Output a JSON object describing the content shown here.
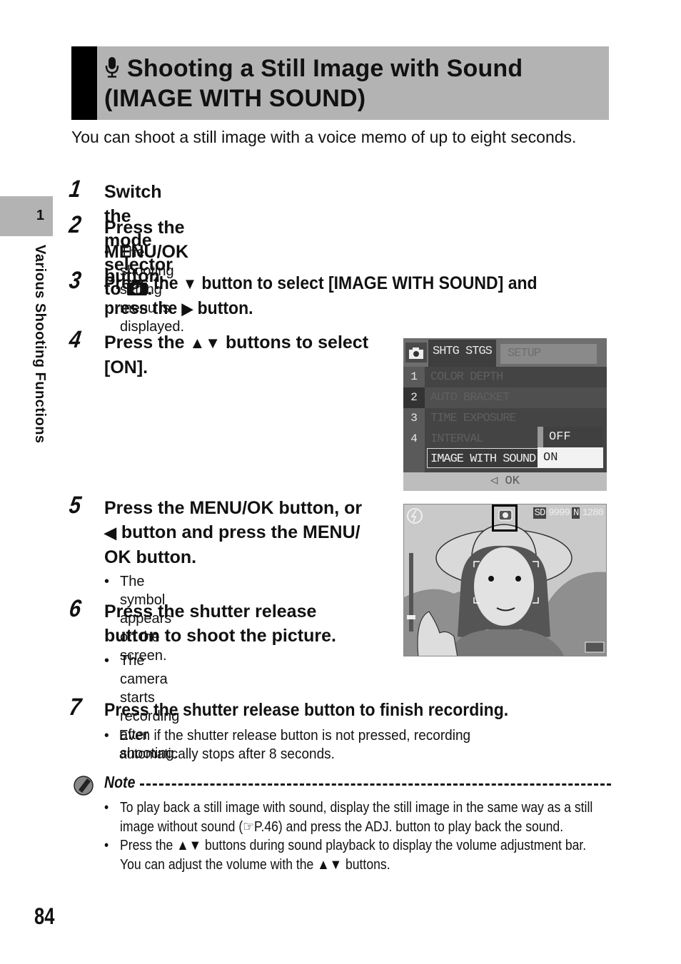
{
  "header": {
    "title_line1": "Shooting a Still Image with Sound",
    "title_line2": "(IMAGE WITH SOUND)",
    "title_icon": "microphone-icon"
  },
  "intro": "You can shoot a still image with a voice memo of up to eight seconds.",
  "sidebar": {
    "chapter_number": "1",
    "chapter_title": "Various Shooting Functions"
  },
  "steps": [
    {
      "number": "1",
      "text_before": "Switch the mode selector to ",
      "icon": "camera-icon",
      "text_after": "."
    },
    {
      "number": "2",
      "text": "Press the MENU/OK button.",
      "bullets": [
        "The shooting setting menu is displayed."
      ]
    },
    {
      "number": "3",
      "line1_before": "Press the ",
      "line1_icon": "▼",
      "line1_after": " button to select [IMAGE WITH SOUND] and",
      "line2_before": "press the ",
      "line2_icon": "▶",
      "line2_after": " button."
    },
    {
      "number": "4",
      "line1_before": "Press the ",
      "line1_icon": "▲▼",
      "line1_after": " buttons to select",
      "line2": "[ON]."
    },
    {
      "number": "5",
      "line1": "Press the MENU/OK button, or",
      "line2_icon": "◀",
      "line2_after": " button and press the MENU/",
      "line3": "OK button.",
      "bullets": [
        "The symbol appears on the screen."
      ]
    },
    {
      "number": "6",
      "line1": "Press the shutter release",
      "line2": "button to shoot the picture.",
      "bullets": [
        "The camera starts recording after",
        "shooting."
      ]
    },
    {
      "number": "7",
      "text": "Press the shutter release button to finish recording.",
      "bullets": [
        "Even if the shutter release button is not pressed, recording",
        "automatically stops after 8 seconds."
      ]
    }
  ],
  "camera_menu": {
    "tab_active": "SHTG STGS",
    "tab_inactive": "SETUP",
    "page_numbers": [
      "1",
      "2",
      "3",
      "4"
    ],
    "items": [
      "COLOR DEPTH",
      "AUTO BRACKET",
      "TIME EXPOSURE",
      "INTERVAL",
      "IMAGE WITH SOUND"
    ],
    "selected_item": "IMAGE WITH SOUND",
    "options": [
      "OFF",
      "ON"
    ],
    "selected_option": "ON",
    "footer": "◁ OK"
  },
  "camera_preview": {
    "card": "SD",
    "remaining_shots": "9999",
    "quality": "N",
    "image_size": "1280",
    "icons": [
      "flash-off-icon",
      "image-with-sound-icon",
      "zoom-bar",
      "battery-icon"
    ]
  },
  "note": {
    "label": "Note",
    "bullets": [
      {
        "line1": "To play back a still image with sound, display the still image in the same way as a still",
        "line2_before": "image without sound (",
        "ref_icon": "☞",
        "line2_ref": "P.46",
        "line2_after": ") and press the ADJ. button to play back the sound."
      },
      {
        "line1_before": "Press the ",
        "line1_icon": "▲▼",
        "line1_after": " buttons during sound playback to display the volume adjustment bar.",
        "line2_before": "You can adjust the volume with the ",
        "line2_icon": "▲▼",
        "line2_after": " buttons."
      }
    ]
  },
  "page_number": "84"
}
